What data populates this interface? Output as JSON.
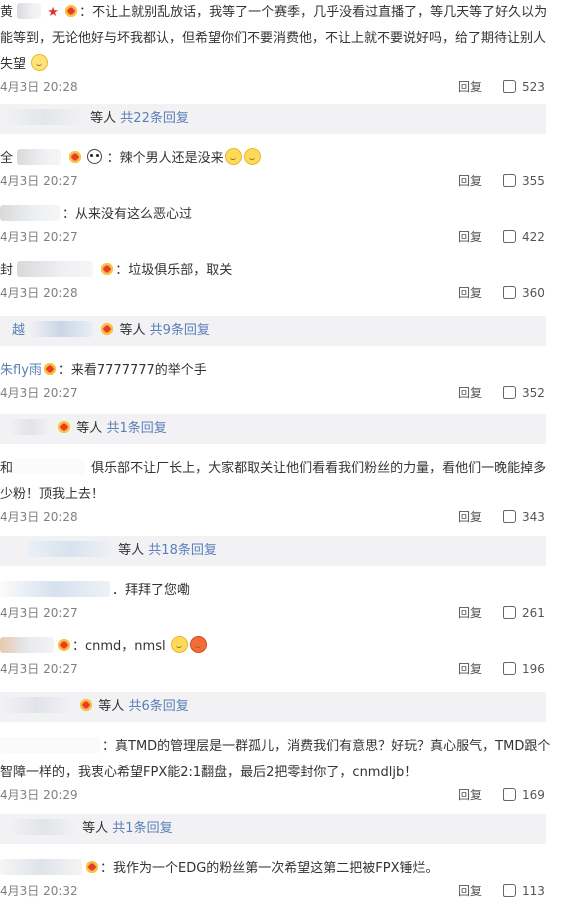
{
  "comments": [
    {
      "name": "黄",
      "text": "：不让上就别乱放话，我等了一个赛季，几乎没看过直播了，等几天等了好久以为能等到，无论他好与坏我都认，但希望你们不要消费他，不让上就不要说好吗，给了期待让别人失望",
      "time": "4月3日 20:28",
      "reply": "回复",
      "likes": "523"
    },
    {
      "name": "全",
      "text": "：辣个男人还是没来",
      "time": "4月3日 20:27",
      "reply": "回复",
      "likes": "355"
    },
    {
      "name": "",
      "text": "：从来没有这么恶心过",
      "time": "4月3日 20:27",
      "reply": "回复",
      "likes": "422"
    },
    {
      "name": "封",
      "text": "：垃圾俱乐部，取关",
      "time": "4月3日 20:28",
      "reply": "回复",
      "likes": "360"
    },
    {
      "name": "朱fly雨",
      "text": "：来看7777777的举个手",
      "time": "4月3日 20:27",
      "reply": "回复",
      "likes": "352"
    },
    {
      "name": "和",
      "text": "俱乐部不让厂长上，大家都取关让他们看看我们粉丝的力量，看他们一晚能掉多少粉！顶我上去！",
      "time": "4月3日 20:28",
      "reply": "回复",
      "likes": "343"
    },
    {
      "name": "",
      "text": "．拜拜了您嘞",
      "time": "4月3日 20:27",
      "reply": "回复",
      "likes": "261"
    },
    {
      "name": "",
      "text": "：cnmd，nmsl",
      "time": "4月3日 20:27",
      "reply": "回复",
      "likes": "196"
    },
    {
      "name": "",
      "text": "：真TMD的管理层是一群孤儿，消费我们有意思？好玩？真心服气，TMD跟个智障一样的，我衷心希望FPX能2:1翻盘，最后2把零封你了，cnmdljb！",
      "time": "4月3日 20:29",
      "reply": "回复",
      "likes": "169"
    },
    {
      "name": "",
      "text": "：我作为一个EDG的粉丝第一次希望这第二把被FPX锤烂。",
      "time": "4月3日 20:32",
      "reply": "回复",
      "likes": "113"
    }
  ],
  "summaries": [
    {
      "prefix": "等人",
      "link": "共22条回复"
    },
    {
      "name": "越",
      "prefix": "等人",
      "link": "共9条回复"
    },
    {
      "prefix": "等人",
      "link": "共1条回复"
    },
    {
      "prefix": "等人",
      "link": "共18条回复"
    },
    {
      "prefix": "等人",
      "link": "共6条回复"
    },
    {
      "prefix": "等人",
      "link": "共1条回复"
    }
  ],
  "icons": {
    "like": "thumbs-up-icon",
    "badge": "vip-crown-icon"
  },
  "colors": {
    "link": "#5a7fb6",
    "summary_bg": "#f2f2f5",
    "time": "#808080"
  }
}
